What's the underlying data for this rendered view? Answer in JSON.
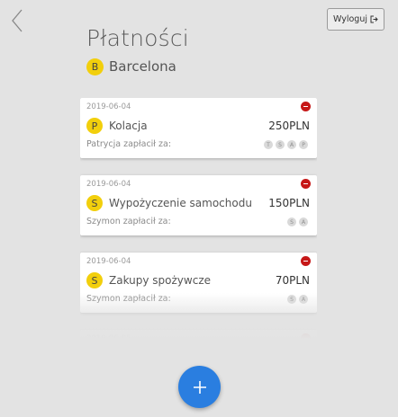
{
  "header": {
    "logout_label": "Wyloguj",
    "title": "Płatności",
    "group": {
      "initial": "B",
      "name": "Barcelona"
    }
  },
  "payments": [
    {
      "date": "2019-06-04",
      "initial": "P",
      "name": "Kolacja",
      "amount": "250PLN",
      "paid_for_label": "Patrycja zapłacił za:",
      "participants": [
        "T",
        "S",
        "A",
        "P"
      ]
    },
    {
      "date": "2019-06-04",
      "initial": "S",
      "name": "Wypożyczenie samochodu",
      "amount": "150PLN",
      "paid_for_label": "Szymon zapłacił za:",
      "participants": [
        "S",
        "A"
      ]
    },
    {
      "date": "2019-06-04",
      "initial": "S",
      "name": "Zakupy spożywcze",
      "amount": "70PLN",
      "paid_for_label": "Szymon zapłacił za:",
      "participants": [
        "S",
        "A"
      ]
    },
    {
      "date": "2019-06-05"
    }
  ],
  "icons": {
    "back": "chevron-left-icon",
    "logout": "logout-icon",
    "add": "plus-icon",
    "delete": "minus-circle-icon"
  },
  "colors": {
    "accent": "#2a7ee0",
    "avatar": "#f2cf0c",
    "delete": "#c61818",
    "background": "#e3e3e3"
  }
}
